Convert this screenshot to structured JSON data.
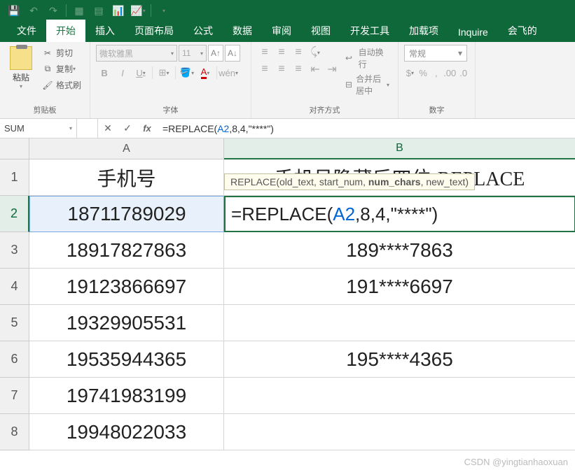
{
  "qat": {
    "save": "💾"
  },
  "tabs": {
    "file": "文件",
    "home": "开始",
    "insert": "插入",
    "page_layout": "页面布局",
    "formulas": "公式",
    "data": "数据",
    "review": "审阅",
    "view": "视图",
    "developer": "开发工具",
    "addins": "加载项",
    "inquire": "Inquire",
    "custom": "会飞的"
  },
  "ribbon": {
    "clipboard": {
      "paste": "粘贴",
      "cut": "剪切",
      "copy": "复制",
      "format_painter": "格式刷",
      "label": "剪贴板"
    },
    "font": {
      "name": "微软雅黑",
      "size": "11",
      "label": "字体",
      "bold": "B",
      "italic": "I",
      "underline": "U"
    },
    "alignment": {
      "wrap": "自动换行",
      "merge": "合并后居中",
      "label": "对齐方式"
    },
    "number": {
      "format": "常规",
      "label": "数字"
    }
  },
  "formula_bar": {
    "name_box": "SUM",
    "formula_pre": "=REPLACE(",
    "formula_ref": "A2",
    "formula_post": ",8,4,\"****\")"
  },
  "tooltip": {
    "func": "REPLACE",
    "p1": "(old_text, start_num, ",
    "p2": "num_chars",
    "p3": ", new_text)"
  },
  "headers": {
    "A": "A",
    "B": "B"
  },
  "rows": [
    "1",
    "2",
    "3",
    "4",
    "5",
    "6",
    "7",
    "8"
  ],
  "cells": {
    "A1": "手机号",
    "B1": "手机号隐藏后四位-REPLACE",
    "A2": "18711789029",
    "B2_pre": "=REPLACE(",
    "B2_ref": "A2",
    "B2_post": ",8,4,\"****\")",
    "A3": "18917827863",
    "B3": "189****7863",
    "A4": "19123866697",
    "B4": "191****6697",
    "A5": "19329905531",
    "B5": "",
    "A6": "19535944365",
    "B6": "195****4365",
    "A7": "19741983199",
    "B7": "",
    "A8": "19948022033",
    "B8": ""
  },
  "watermark": "CSDN @yingtianhaoxuan"
}
